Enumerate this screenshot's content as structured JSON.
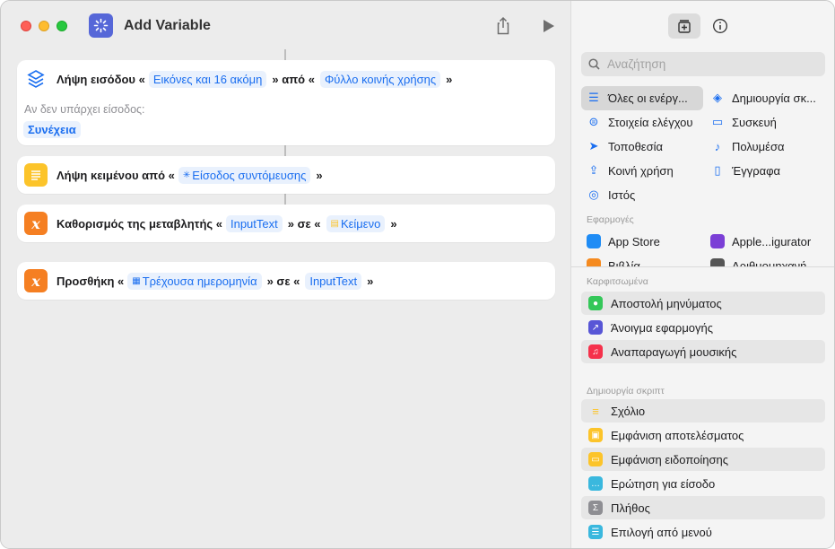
{
  "window": {
    "title": "Add Variable"
  },
  "actions": [
    {
      "name": "get-input",
      "label": "Λήψη εισόδου «",
      "token1": "Εικόνες και 16 ακόμη",
      "mid": "» από «",
      "token2": "Φύλλο κοινής χρήσης",
      "end": "»",
      "no_input_label": "Αν δεν υπάρχει είσοδος:",
      "no_input_value": "Συνέχεια"
    },
    {
      "name": "get-text",
      "label": "Λήψη κειμένου από «",
      "token1": "Είσοδος συντόμευσης",
      "end": "»"
    },
    {
      "name": "set-variable",
      "label": "Καθορισμός της μεταβλητής «",
      "token1": "InputText",
      "mid": "» σε «",
      "token2": "Κείμενο",
      "end": "»"
    },
    {
      "name": "add-to-variable",
      "label": "Προσθήκη «",
      "token1": "Τρέχουσα ημερομηνία",
      "mid": "» σε «",
      "token2": "InputText",
      "end": "»"
    }
  ],
  "sidebar": {
    "search_placeholder": "Αναζήτηση",
    "categories": [
      {
        "label": "Όλες οι ενέργ...",
        "icon": "list-icon"
      },
      {
        "label": "Δημιουργία σκ...",
        "icon": "scripting-icon"
      },
      {
        "label": "Στοιχεία ελέγχου",
        "icon": "toggle-icon"
      },
      {
        "label": "Συσκευή",
        "icon": "device-icon"
      },
      {
        "label": "Τοποθεσία",
        "icon": "location-icon"
      },
      {
        "label": "Πολυμέσα",
        "icon": "music-note-icon"
      },
      {
        "label": "Κοινή χρήση",
        "icon": "share-icon"
      },
      {
        "label": "Έγγραφα",
        "icon": "document-icon"
      },
      {
        "label": "Ιστός",
        "icon": "compass-icon"
      }
    ],
    "apps_header": "Εφαρμογές",
    "apps": [
      {
        "label": "App Store",
        "color": "#1f8cf5"
      },
      {
        "label": "Apple...igurator",
        "color": "#7b3fd6"
      },
      {
        "label": "Βιβλία",
        "color": "#f58a1f"
      },
      {
        "label": "Αριθμομηχανή",
        "color": "#555555"
      }
    ],
    "pinned_header": "Καρφιτσωμένα",
    "pinned": [
      {
        "label": "Αποστολή μηνύματος",
        "color": "#34c759",
        "icon": "message-icon"
      },
      {
        "label": "Άνοιγμα εφαρμογής",
        "color": "#5856d6",
        "icon": "open-app-icon"
      },
      {
        "label": "Αναπαραγωγή μουσικής",
        "color": "#f5314b",
        "icon": "music-icon"
      }
    ],
    "scripting_header": "Δημιουργία σκριπτ",
    "scripting": [
      {
        "label": "Σχόλιο",
        "color": "#fcc42a",
        "icon": "comment-icon"
      },
      {
        "label": "Εμφάνιση αποτελέσματος",
        "color": "#fcc42a",
        "icon": "result-icon"
      },
      {
        "label": "Εμφάνιση ειδοποίησης",
        "color": "#fcc42a",
        "icon": "alert-icon"
      },
      {
        "label": "Ερώτηση για είσοδο",
        "color": "#3ab8de",
        "icon": "ask-input-icon"
      },
      {
        "label": "Πλήθος",
        "color": "#8e8e93",
        "icon": "sigma-icon"
      },
      {
        "label": "Επιλογή από μενού",
        "color": "#3ab8de",
        "icon": "menu-icon"
      }
    ]
  }
}
